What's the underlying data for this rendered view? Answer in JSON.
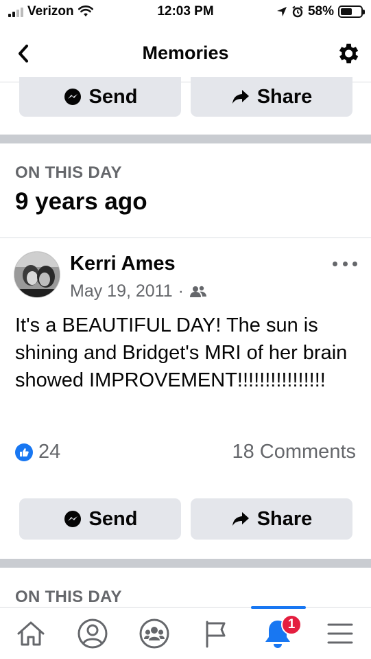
{
  "status_bar": {
    "carrier": "Verizon",
    "time": "12:03 PM",
    "battery": "58%",
    "battery_level": 0.58
  },
  "header": {
    "title": "Memories"
  },
  "top_actions": {
    "send_label": "Send",
    "share_label": "Share"
  },
  "memory": {
    "section_label": "ON THIS DAY",
    "years_ago": "9 years ago",
    "post": {
      "author": "Kerri Ames",
      "date": "May 19, 2011",
      "separator": "·",
      "text": "It's a BEAUTIFUL DAY! The sun is shining and Bridget's MRI of her brain showed IMPROVEMENT!!!!!!!!!!!!!!!!",
      "likes": "24",
      "comments": "18 Comments"
    },
    "actions": {
      "send_label": "Send",
      "share_label": "Share"
    }
  },
  "next_section": {
    "section_label": "ON THIS DAY"
  },
  "tab_bar": {
    "tabs": [
      {
        "icon": "home-icon"
      },
      {
        "icon": "profile-icon"
      },
      {
        "icon": "groups-icon"
      },
      {
        "icon": "pages-flag-icon"
      },
      {
        "icon": "notifications-bell-icon",
        "badge": "1",
        "active": true
      },
      {
        "icon": "menu-icon"
      }
    ]
  },
  "colors": {
    "accent": "#1877f2",
    "badge": "#e41e3f",
    "button_bg": "#e4e6eb",
    "muted_text": "#65676b"
  }
}
